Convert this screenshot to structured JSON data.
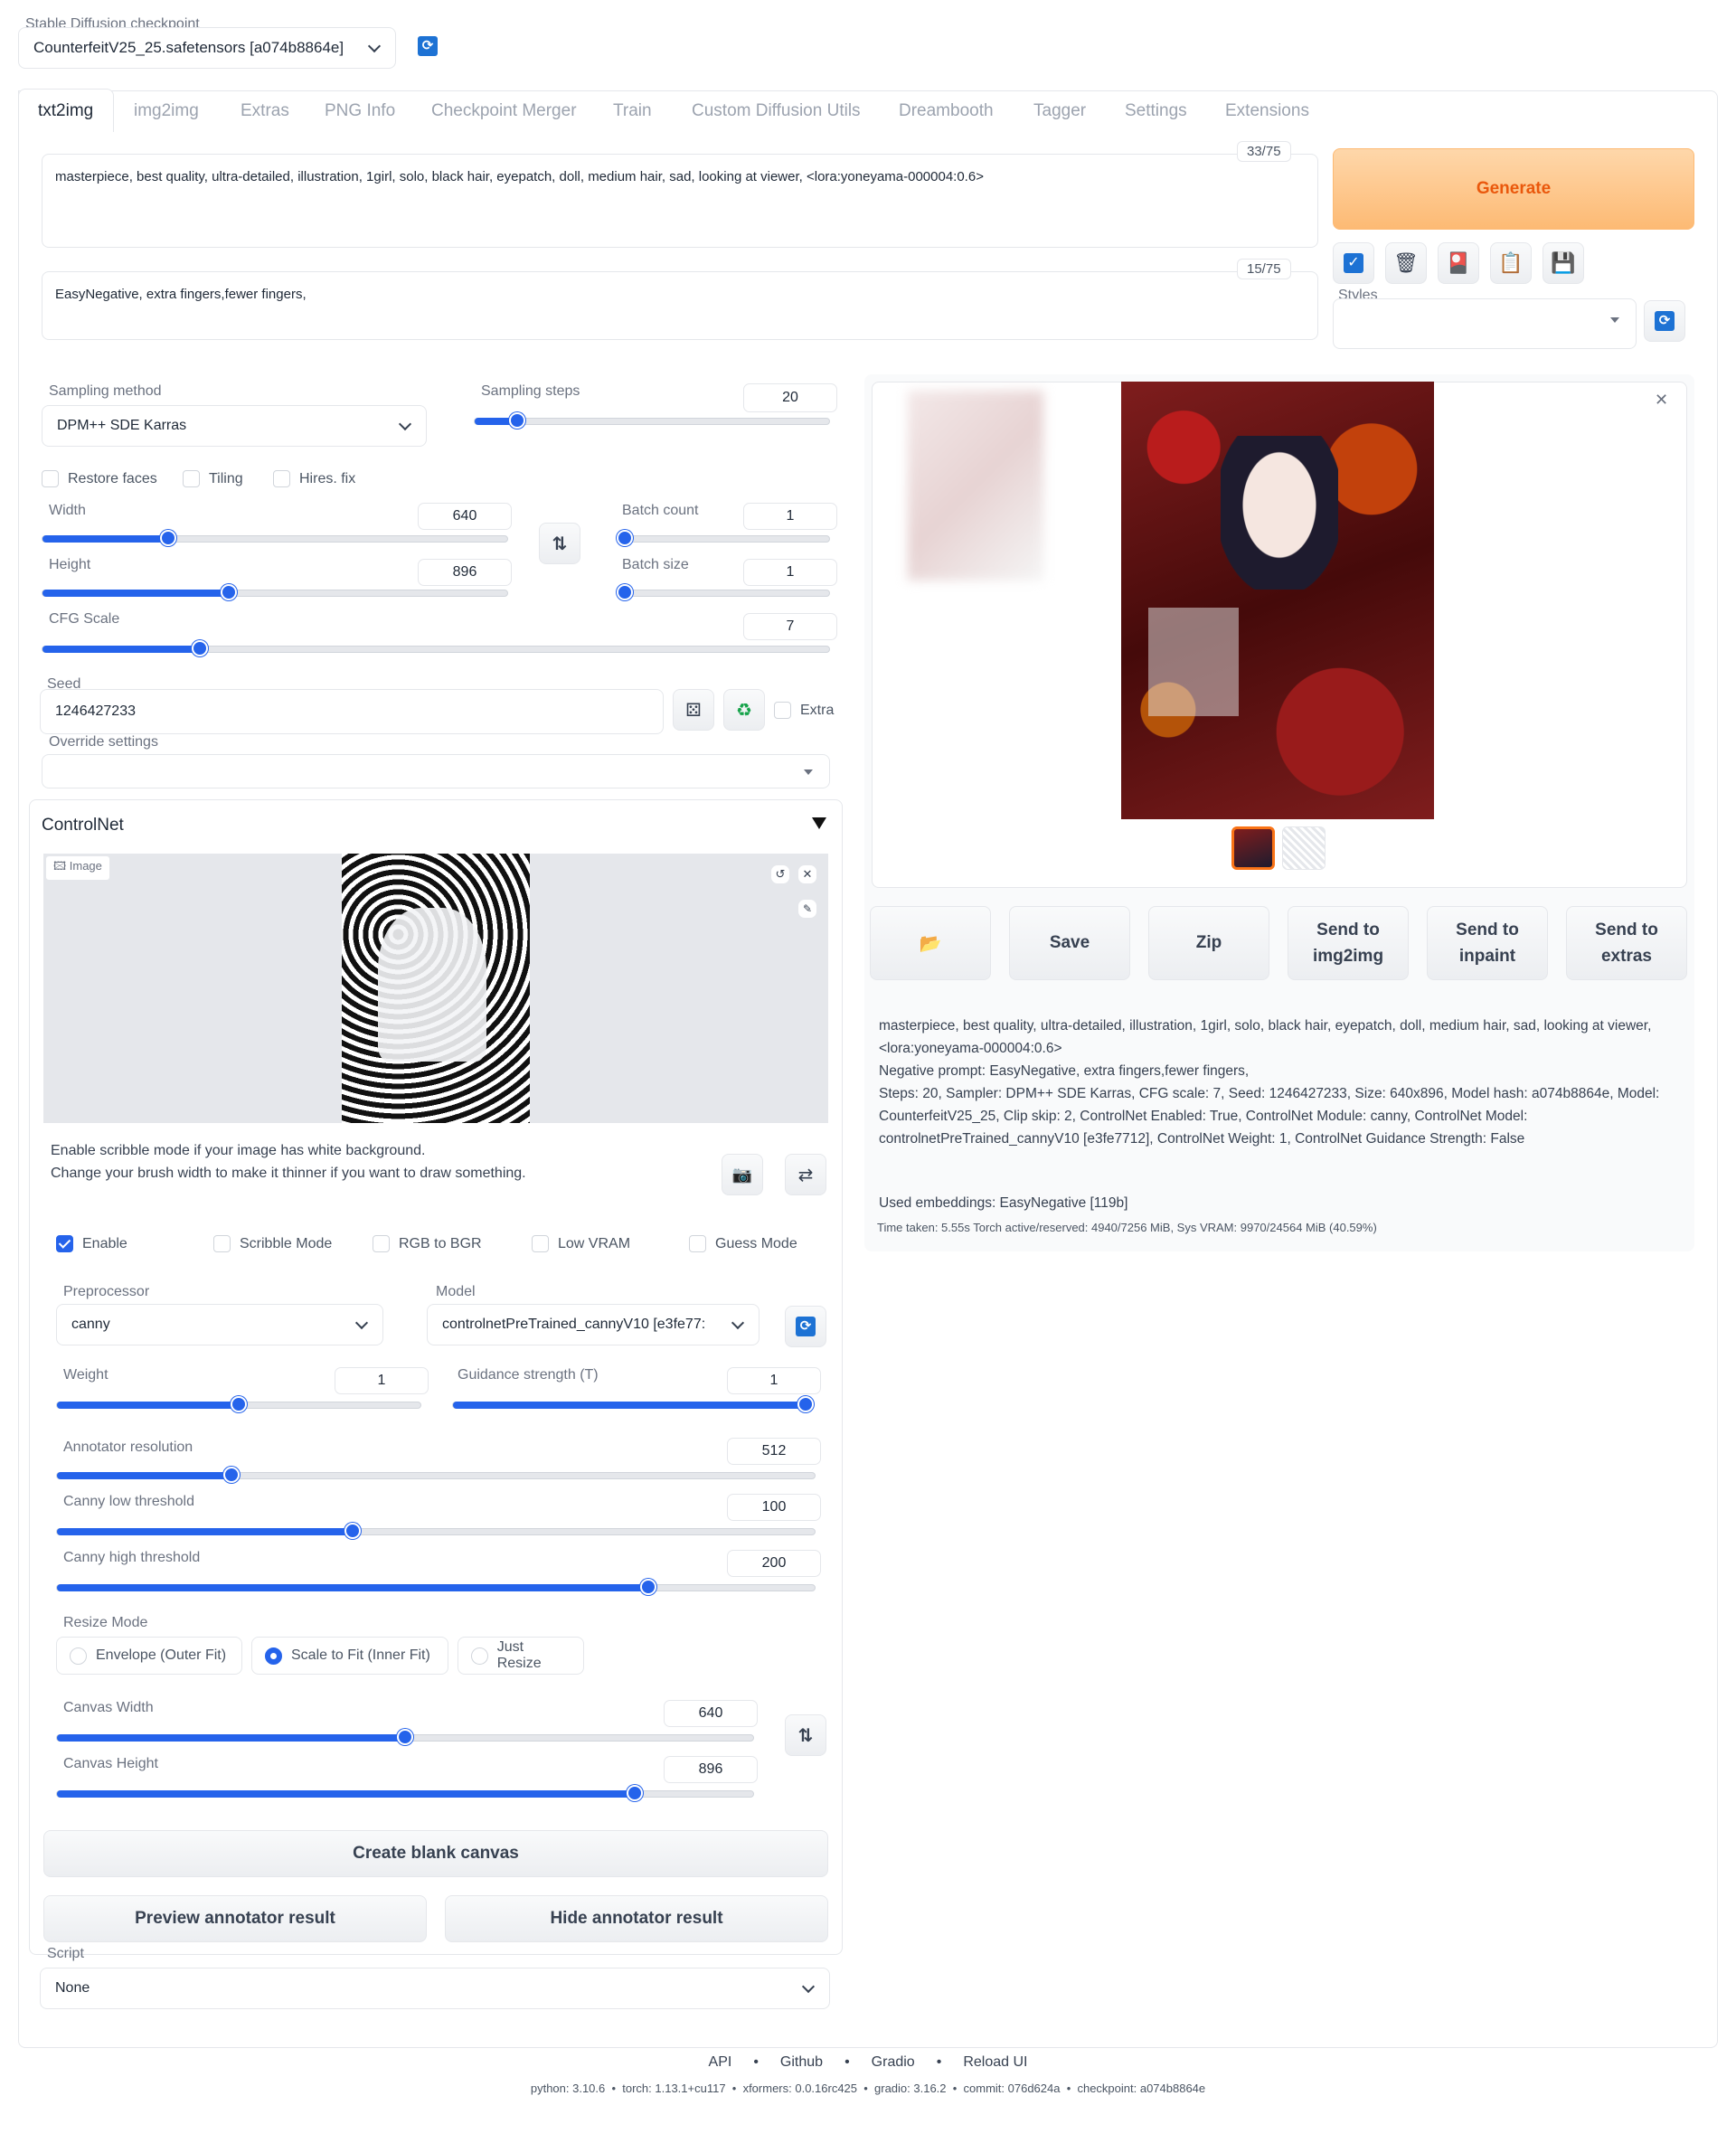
{
  "checkpoint": {
    "label": "Stable Diffusion checkpoint",
    "value": "CounterfeitV25_25.safetensors [a074b8864e]"
  },
  "tabs": [
    "txt2img",
    "img2img",
    "Extras",
    "PNG Info",
    "Checkpoint Merger",
    "Train",
    "Custom Diffusion Utils",
    "Dreambooth",
    "Tagger",
    "Settings",
    "Extensions"
  ],
  "prompt": {
    "text": "masterpiece, best quality, ultra-detailed, illustration, 1girl, solo, black hair, eyepatch, doll, medium hair, sad, looking at viewer,  <lora:yoneyama-000004:0.6>",
    "counter": "33/75"
  },
  "negative": {
    "text": "EasyNegative, extra fingers,fewer fingers,",
    "counter": "15/75"
  },
  "generate": {
    "label": "Generate"
  },
  "styles": {
    "label": "Styles",
    "value": ""
  },
  "sampling": {
    "method_label": "Sampling method",
    "method": "DPM++ SDE Karras",
    "steps_label": "Sampling steps",
    "steps": "20"
  },
  "checks": {
    "restore_faces": "Restore faces",
    "tiling": "Tiling",
    "hires": "Hires. fix"
  },
  "size": {
    "width_label": "Width",
    "width": "640",
    "height_label": "Height",
    "height": "896"
  },
  "batch": {
    "count_label": "Batch count",
    "count": "1",
    "size_label": "Batch size",
    "size": "1"
  },
  "cfg": {
    "label": "CFG Scale",
    "value": "7"
  },
  "seed": {
    "label": "Seed",
    "value": "1246427233",
    "extra": "Extra"
  },
  "override": {
    "label": "Override settings",
    "value": ""
  },
  "controlnet": {
    "title": "ControlNet",
    "image_tag": "Image",
    "hint1": "Enable scribble mode if your image has white background.",
    "hint2": "Change your brush width to make it thinner if you want to draw something.",
    "enable": "Enable",
    "scribble": "Scribble Mode",
    "rgb": "RGB to BGR",
    "lowvram": "Low VRAM",
    "guess": "Guess Mode",
    "pre_label": "Preprocessor",
    "pre": "canny",
    "model_label": "Model",
    "model": "controlnetPreTrained_cannyV10 [e3fe77:",
    "weight_label": "Weight",
    "weight": "1",
    "guidance_label": "Guidance strength (T)",
    "guidance": "1",
    "annot_label": "Annotator resolution",
    "annot": "512",
    "low_label": "Canny low threshold",
    "low": "100",
    "high_label": "Canny high threshold",
    "high": "200",
    "resize_label": "Resize Mode",
    "resize_opts": [
      "Envelope (Outer Fit)",
      "Scale to Fit (Inner Fit)",
      "Just Resize"
    ],
    "cw_label": "Canvas Width",
    "cw": "640",
    "ch_label": "Canvas Height",
    "ch": "896",
    "create": "Create blank canvas",
    "preview": "Preview annotator result",
    "hide": "Hide annotator result"
  },
  "script": {
    "label": "Script",
    "value": "None"
  },
  "output": {
    "buttons": {
      "save": "Save",
      "zip": "Zip",
      "img2img": "Send to\nimg2img",
      "inpaint": "Send to\ninpaint",
      "extras": "Send to\nextras"
    },
    "info1": "masterpiece, best quality, ultra-detailed, illustration, 1girl, solo, black hair, eyepatch, doll, medium hair, sad, looking at viewer, <lora:yoneyama-000004:0.6>",
    "info2": "Negative prompt: EasyNegative, extra fingers,fewer fingers,",
    "info3": "Steps: 20, Sampler: DPM++ SDE Karras, CFG scale: 7, Seed: 1246427233, Size: 640x896, Model hash: a074b8864e, Model: CounterfeitV25_25, Clip skip: 2, ControlNet Enabled: True, ControlNet Module: canny, ControlNet Model: controlnetPreTrained_cannyV10 [e3fe7712], ControlNet Weight: 1, ControlNet Guidance Strength: False",
    "embeddings": "Used embeddings: EasyNegative [119b]",
    "time": "Time taken: 5.55s  Torch active/reserved: 4940/7256 MiB, Sys VRAM: 9970/24564 MiB (40.59%)"
  },
  "footer": {
    "links": [
      "API",
      "Github",
      "Gradio",
      "Reload UI"
    ],
    "versions": "python: 3.10.6  •  torch: 1.13.1+cu117  •  xformers: 0.0.16rc425  •  gradio: 3.16.2  •  commit: 076d624a  •  checkpoint: a074b8864e"
  },
  "sliders": {
    "steps": 0.12,
    "width": 0.27,
    "height": 0.4,
    "batch_count": 0,
    "batch_size": 0,
    "cfg": 0.2,
    "weight": 0.5,
    "guidance": 1,
    "annot": 0.23,
    "low": 0.39,
    "high": 0.78,
    "cw": 0.5,
    "ch": 0.83
  }
}
